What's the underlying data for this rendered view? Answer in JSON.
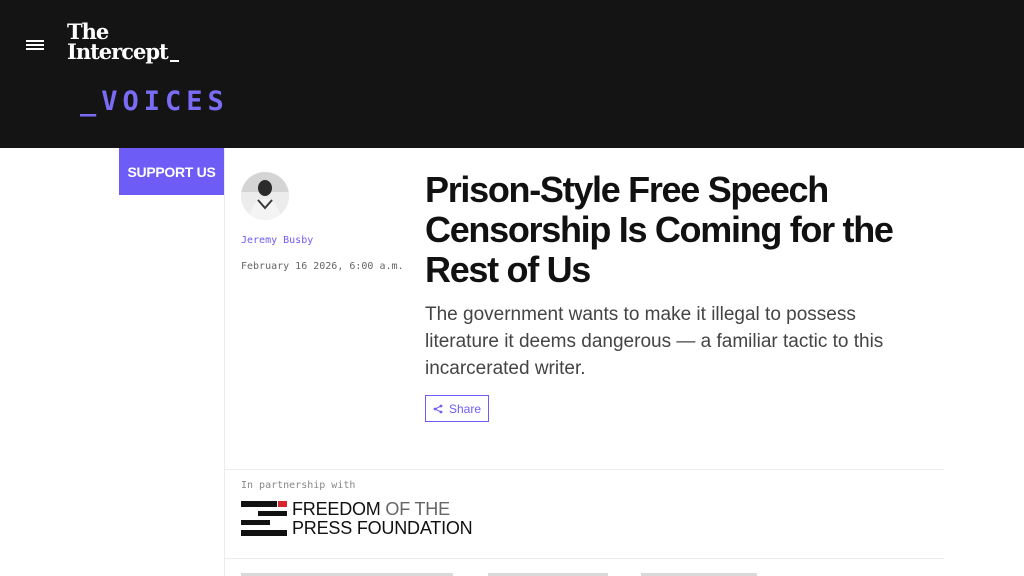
{
  "header": {
    "menu_icon": "hamburger-menu-icon",
    "logo_line1": "The",
    "logo_line2": "Intercept",
    "section": "_VOICES",
    "background": "#141414",
    "accent": "#6e5cf6"
  },
  "support_button": {
    "label": "SUPPORT US"
  },
  "byline": {
    "author": "Jeremy Busby",
    "date": "February 16 2026, 6:00 a.m."
  },
  "article": {
    "headline": "Prison-Style Free Speech Censorship Is Coming for the Rest of Us",
    "dek": "The government wants to make it illegal to possess literature it deems dangerous — a familiar tactic to this incarcerated writer.",
    "share_label": "Share",
    "share_icon": "share-icon"
  },
  "partnership": {
    "label": "In partnership with",
    "org_line1_strong": "FREEDOM",
    "org_line1_rest": " OF THE",
    "org_line2": "PRESS FOUNDATION",
    "logo_accent": "#d7262b"
  }
}
